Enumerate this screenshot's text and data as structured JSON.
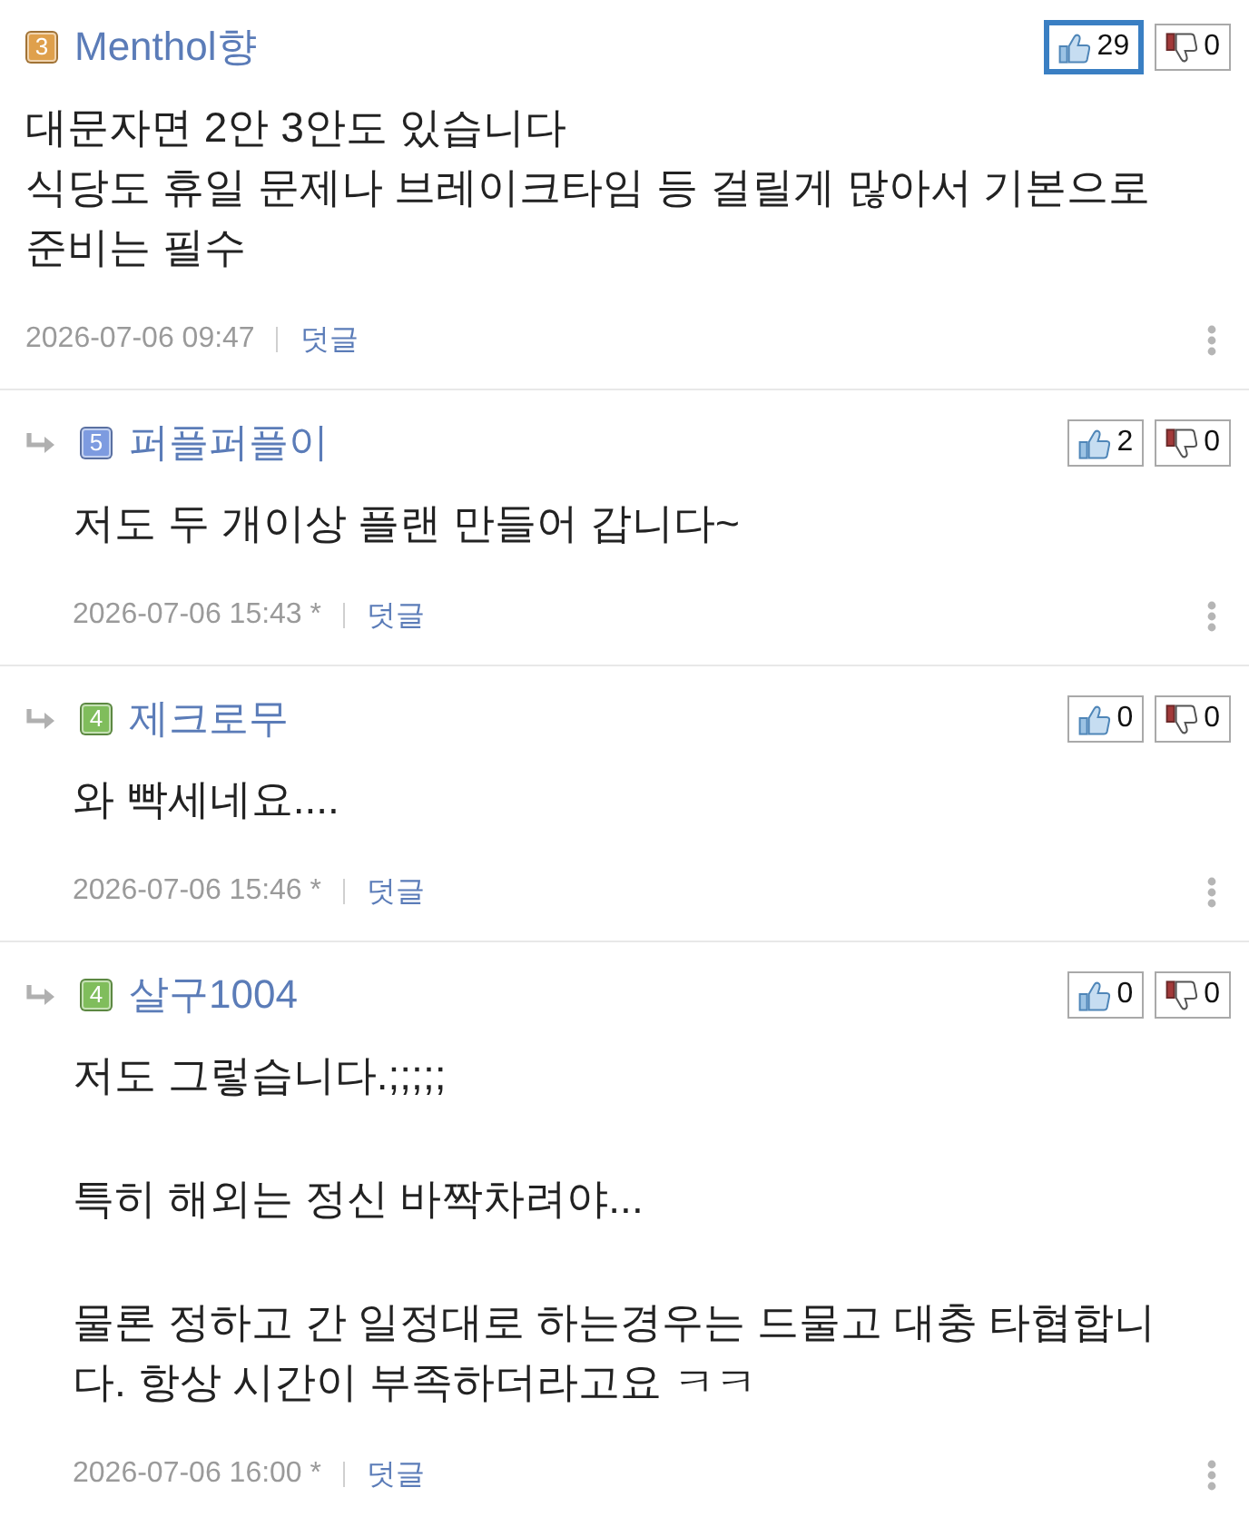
{
  "comments": [
    {
      "kind": "comment",
      "level": "3",
      "color": "#dfa04c",
      "author": "Menthol향",
      "votes": [
        {
          "kind": "up",
          "count": "29",
          "selected": true
        },
        {
          "kind": "down",
          "count": "0",
          "selected": false
        }
      ],
      "paragraphs": [
        [
          "대문자면 2안 3안도 있습니다",
          "식당도 휴일 문제나 브레이크타임 등 걸릴게 많아서 기본으로 준비는 필수"
        ]
      ],
      "date": "2026-07-06 09:47",
      "reply_link": "덧글"
    },
    {
      "kind": "reply",
      "level": "5",
      "color": "#7d9be0",
      "author": "퍼플퍼플이",
      "votes": [
        {
          "kind": "up",
          "count": "2",
          "selected": false
        },
        {
          "kind": "down",
          "count": "0",
          "selected": false
        }
      ],
      "paragraphs": [
        [
          "저도 두 개이상 플랜 만들어 갑니다~"
        ]
      ],
      "date": "2026-07-06 15:43 *",
      "reply_link": "덧글"
    },
    {
      "kind": "reply",
      "level": "4",
      "color": "#80bd5c",
      "author": "제크로무",
      "votes": [
        {
          "kind": "up",
          "count": "0",
          "selected": false
        },
        {
          "kind": "down",
          "count": "0",
          "selected": false
        }
      ],
      "paragraphs": [
        [
          "와 빡세네요...."
        ]
      ],
      "date": "2026-07-06 15:46 *",
      "reply_link": "덧글"
    },
    {
      "kind": "reply",
      "level": "4",
      "color": "#80bd5c",
      "author": "살구1004",
      "votes": [
        {
          "kind": "up",
          "count": "0",
          "selected": false
        },
        {
          "kind": "down",
          "count": "0",
          "selected": false
        }
      ],
      "paragraphs": [
        [
          "저도 그렇습니다.;;;;;"
        ],
        [
          "특히 해외는 정신 바짝차려야..."
        ],
        [
          "물론 정하고 간 일정대로 하는경우는 드물고 대충 타협합니다. 항상 시간이 부족하더라고요 ㅋㅋ"
        ]
      ],
      "date": "2026-07-06 16:00 *",
      "reply_link": "덧글"
    }
  ]
}
